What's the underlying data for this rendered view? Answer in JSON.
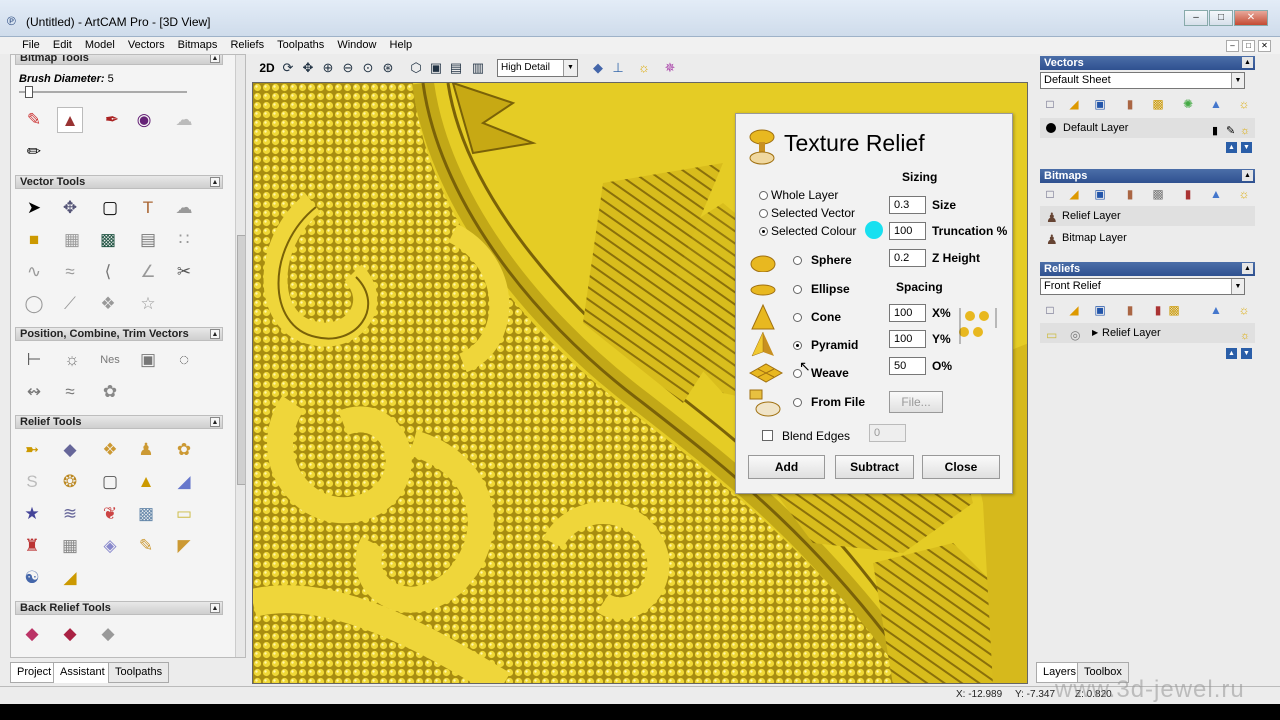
{
  "window": {
    "title": "(Untitled) - ArtCAM Pro - [3D View]"
  },
  "menu": [
    "File",
    "Edit",
    "Model",
    "Vectors",
    "Bitmaps",
    "Reliefs",
    "Toolpaths",
    "Window",
    "Help"
  ],
  "left_panel": {
    "bitmap_tools": {
      "title": "Bitmap Tools",
      "brush_label": "Brush Diameter:",
      "brush_value": "5"
    },
    "sections": {
      "vector_tools": "Vector Tools",
      "position": "Position, Combine, Trim Vectors",
      "relief_tools": "Relief Tools",
      "back_relief_tools": "Back Relief Tools"
    },
    "tabs": [
      "Project",
      "Assistant",
      "Toolpaths"
    ]
  },
  "view_toolbar": {
    "mode": "2D",
    "detail_level": "High Detail"
  },
  "dialog": {
    "title": "Texture Relief",
    "sizing_label": "Sizing",
    "spacing_label": "Spacing",
    "scope_options": [
      "Whole Layer",
      "Selected Vector",
      "Selected Colour"
    ],
    "selected_scope": "Selected Colour",
    "shape_options": [
      "Sphere",
      "Ellipse",
      "Cone",
      "Pyramid",
      "Weave",
      "From File"
    ],
    "selected_shape": "Pyramid",
    "size_value": "0.3",
    "size_label": "Size",
    "truncation_value": "100",
    "truncation_label": "Truncation %",
    "zheight_value": "0.2",
    "zheight_label": "Z Height",
    "x_value": "100",
    "x_label": "X%",
    "y_value": "100",
    "y_label": "Y%",
    "o_value": "50",
    "o_label": "O%",
    "file_button": "File...",
    "blend_edges_label": "Blend Edges",
    "blend_edges_value": "0",
    "add_button": "Add",
    "subtract_button": "Subtract",
    "close_button": "Close"
  },
  "right_panel": {
    "vectors": {
      "title": "Vectors",
      "sheet": "Default Sheet",
      "layers": [
        "Default Layer"
      ]
    },
    "bitmaps": {
      "title": "Bitmaps",
      "layers": [
        "Relief Layer",
        "Bitmap Layer"
      ]
    },
    "reliefs": {
      "title": "Reliefs",
      "relief": "Front Relief",
      "layers": [
        "Relief Layer"
      ]
    },
    "tabs": [
      "Layers",
      "Toolbox"
    ]
  },
  "status": {
    "x": "X: -12.989",
    "y": "Y: -7.347",
    "z": "Z: 0.820"
  },
  "watermark": "www.3d-jewel.ru",
  "colors": {
    "relief": "#e5cc25",
    "panel_header": "#2f5190",
    "highlight": "#18e0f0"
  }
}
